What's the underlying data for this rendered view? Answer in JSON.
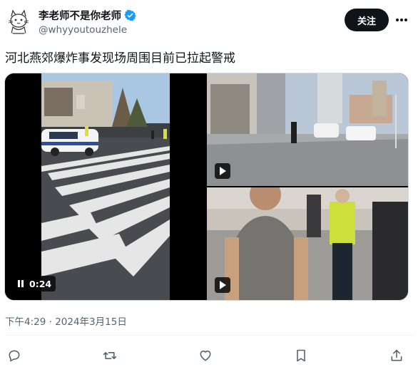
{
  "author": {
    "display_name": "李老师不是你老师",
    "handle": "@whyyoutouzhele",
    "verified": true,
    "avatar": "cat-sketch-avatar"
  },
  "follow_label": "关注",
  "tweet_text": "河北燕郊爆炸事发现场周围目前已拉起警戒",
  "media": {
    "video_duration": "0:24",
    "video_state": "playing",
    "thumbnails": [
      {
        "icon": "play-icon"
      },
      {
        "icon": "play-icon"
      }
    ]
  },
  "timestamp": "下午4:29 · 2024年3月15日",
  "actions": [
    "reply-icon",
    "retweet-icon",
    "like-icon",
    "bookmark-icon",
    "share-icon"
  ],
  "colors": {
    "verified_blue": "#1d9bf0",
    "text_primary": "#0f1419",
    "text_secondary": "#536471",
    "follow_button": "#0f1419"
  }
}
